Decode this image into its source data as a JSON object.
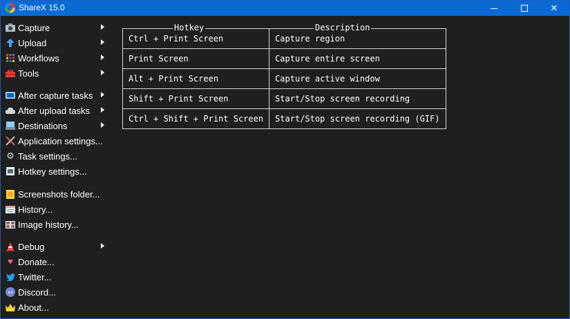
{
  "window": {
    "title": "ShareX 15.0"
  },
  "menu": {
    "items": [
      {
        "label": "Capture",
        "icon": "camera-icon",
        "submenu": true
      },
      {
        "label": "Upload",
        "icon": "upload-arrow-icon",
        "submenu": true
      },
      {
        "label": "Workflows",
        "icon": "workflows-grid-icon",
        "submenu": true
      },
      {
        "label": "Tools",
        "icon": "toolbox-icon",
        "submenu": true
      },
      {
        "label": "After capture tasks",
        "icon": "after-capture-icon",
        "submenu": true
      },
      {
        "label": "After upload tasks",
        "icon": "cloud-upload-icon",
        "submenu": true
      },
      {
        "label": "Destinations",
        "icon": "destinations-icon",
        "submenu": true
      },
      {
        "label": "Application settings...",
        "icon": "wrench-screwdriver-icon",
        "submenu": false
      },
      {
        "label": "Task settings...",
        "icon": "gear-icon",
        "submenu": false
      },
      {
        "label": "Hotkey settings...",
        "icon": "keyboard-icon",
        "submenu": false
      },
      {
        "label": "Screenshots folder...",
        "icon": "folder-icon",
        "submenu": false
      },
      {
        "label": "History...",
        "icon": "history-icon",
        "submenu": false
      },
      {
        "label": "Image history...",
        "icon": "image-history-icon",
        "submenu": false
      },
      {
        "label": "Debug",
        "icon": "traffic-cone-icon",
        "submenu": true
      },
      {
        "label": "Donate...",
        "icon": "heart-icon",
        "submenu": false
      },
      {
        "label": "Twitter...",
        "icon": "twitter-bird-icon",
        "submenu": false
      },
      {
        "label": "Discord...",
        "icon": "discord-icon",
        "submenu": false
      },
      {
        "label": "About...",
        "icon": "crown-icon",
        "submenu": false
      }
    ]
  },
  "hotkeys": {
    "header_hotkey": "Hotkey",
    "header_description": "Description",
    "rows": [
      {
        "hotkey": "Ctrl + Print Screen",
        "description": "Capture region"
      },
      {
        "hotkey": "Print Screen",
        "description": "Capture entire screen"
      },
      {
        "hotkey": "Alt + Print Screen",
        "description": "Capture active window"
      },
      {
        "hotkey": "Shift + Print Screen",
        "description": "Start/Stop screen recording"
      },
      {
        "hotkey": "Ctrl + Shift + Print Screen",
        "description": "Start/Stop screen recording (GIF)"
      }
    ]
  },
  "colors": {
    "titlebar": "#0a6ad6",
    "background": "#1f1f1f",
    "text": "#ffffff",
    "table_border": "#d9d9d9"
  }
}
